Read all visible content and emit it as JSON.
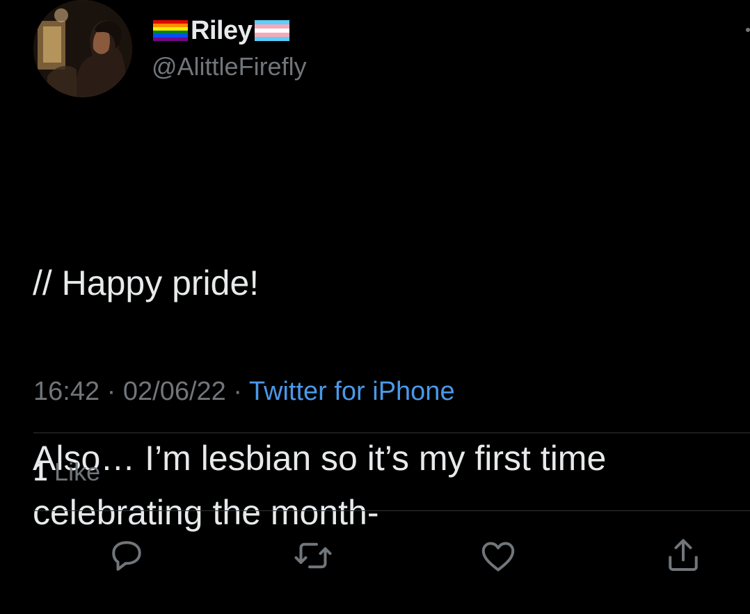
{
  "author": {
    "display_name": "Riley",
    "handle": "@AlittleFirefly",
    "name_prefix_icon": "rainbow-pride-flag",
    "name_suffix_icon": "transgender-pride-flag"
  },
  "tweet": {
    "line1": "// Happy pride!",
    "line2": "Also… I’m lesbian so it’s my first time celebrating the month-"
  },
  "meta": {
    "time": "16:42",
    "separator": " · ",
    "date": "02/06/22",
    "source": "Twitter for iPhone"
  },
  "engagement": {
    "likes_count": "1",
    "likes_label": "Like"
  },
  "actions": {
    "reply_icon": "reply-icon",
    "retweet_icon": "retweet-icon",
    "like_icon": "heart-icon",
    "share_icon": "share-icon"
  },
  "colors": {
    "background": "#000000",
    "text_primary": "#e7e9ea",
    "text_secondary": "#71767b",
    "link": "#4a99e9",
    "divider": "#2f3336"
  }
}
